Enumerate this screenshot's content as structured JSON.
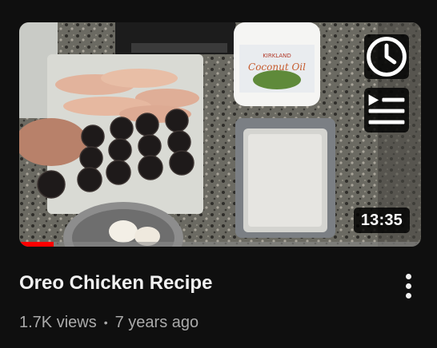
{
  "video": {
    "title": "Oreo Chicken Recipe",
    "views": "1.7K views",
    "separator": "•",
    "age": "7 years ago",
    "duration": "13:35",
    "watch_progress": 0.085,
    "thumbnail_label": "Coconut Oil"
  },
  "icons": {
    "watch_later": "clock-icon",
    "add_to_queue": "add-to-queue-icon",
    "more": "more-vertical-icon"
  },
  "colors": {
    "background": "#0f0f0f",
    "title": "#f1f1f1",
    "meta": "#aaaaaa",
    "progress": "#ff0000"
  }
}
